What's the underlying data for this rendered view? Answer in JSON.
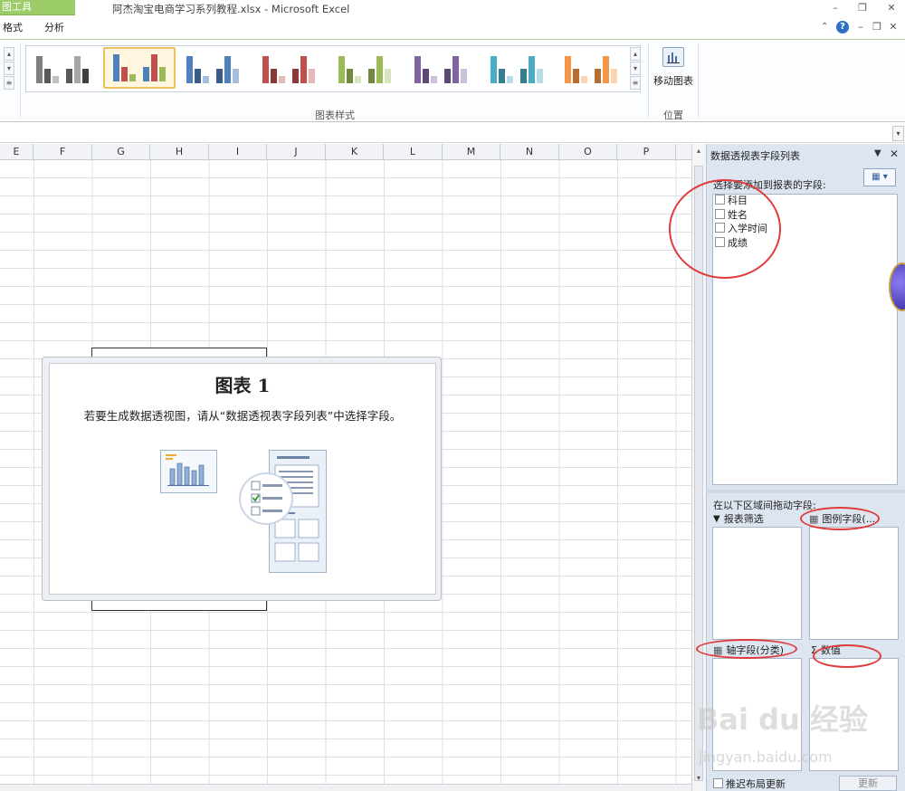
{
  "window": {
    "context_tab": "图工具",
    "title": "阿杰淘宝电商学习系列教程.xlsx - Microsoft Excel"
  },
  "ribbon": {
    "tabs": [
      "格式",
      "分析"
    ],
    "chart_styles_label": "图表样式",
    "move_chart_label": "移动图表",
    "location_label": "位置"
  },
  "sheet": {
    "columns": [
      "E",
      "F",
      "G",
      "H",
      "I",
      "J",
      "K",
      "L",
      "M",
      "N",
      "O",
      "P"
    ]
  },
  "chart": {
    "title": "图表 1",
    "message": "若要生成数据透视图，请从“数据透视表字段列表”中选择字段。"
  },
  "field_list": {
    "title": "数据透视表字段列表",
    "choose_label": "选择要添加到报表的字段:",
    "fields": [
      "科目",
      "姓名",
      "入学时间",
      "成绩"
    ],
    "drag_label": "在以下区域间拖动字段:",
    "zones": {
      "report_filter": "报表筛选",
      "legend_fields": "图例字段(...",
      "axis_fields": "轴字段(分类)",
      "values": "数值"
    },
    "defer_label": "推迟布局更新",
    "update_label": "更新"
  },
  "watermark": {
    "brand": "Bai du 经验",
    "url": "jingyan.baidu.com"
  }
}
